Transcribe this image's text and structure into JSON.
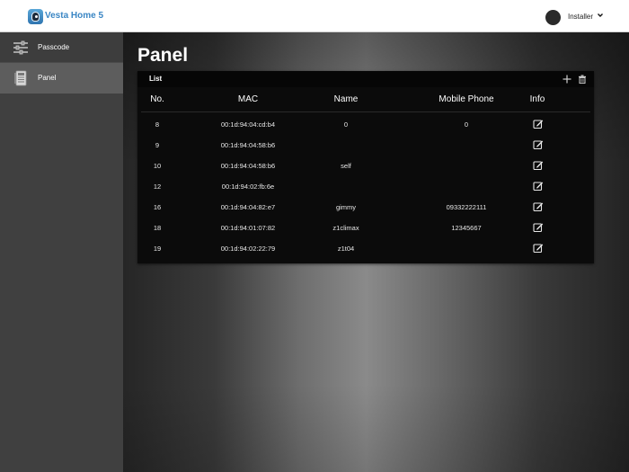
{
  "header": {
    "brand": "Vesta Home 5",
    "user_name": "Installer",
    "icons": {
      "logo": "vesta-logo-icon",
      "caret": "chevron-down-icon",
      "avatar": "user-avatar"
    }
  },
  "sidebar": {
    "items": [
      {
        "label": "Passcode",
        "icon": "sliders-icon"
      },
      {
        "label": "Panel",
        "icon": "panel-device-icon",
        "active": true
      }
    ]
  },
  "main": {
    "title": "Panel",
    "list": {
      "title": "List",
      "actions": [
        "add-icon",
        "trash-icon"
      ],
      "columns": [
        "No.",
        "MAC",
        "Name",
        "Mobile Phone",
        "Info"
      ],
      "rows": [
        {
          "no": "8",
          "mac": "00:1d:94:04:cd:b4",
          "name": "0",
          "phone": "0"
        },
        {
          "no": "9",
          "mac": "00:1d:94:04:58:b6",
          "name": "",
          "phone": ""
        },
        {
          "no": "10",
          "mac": "00:1d:94:04:58:b6",
          "name": "self",
          "phone": ""
        },
        {
          "no": "12",
          "mac": "00:1d:94:02:fb:6e",
          "name": "",
          "phone": ""
        },
        {
          "no": "16",
          "mac": "00:1d:94:04:82:e7",
          "name": "gimmy",
          "phone": "09332222111"
        },
        {
          "no": "18",
          "mac": "00:1d:94:01:07:82",
          "name": "z1climax",
          "phone": "12345667"
        },
        {
          "no": "19",
          "mac": "00:1d:94:02:22:79",
          "name": "z1t04",
          "phone": ""
        }
      ]
    }
  },
  "colors": {
    "brand": "#3a86c4",
    "sidebar": "#404040",
    "sidebar_active": "#5d5d5d",
    "card": "#0b0b0b"
  }
}
